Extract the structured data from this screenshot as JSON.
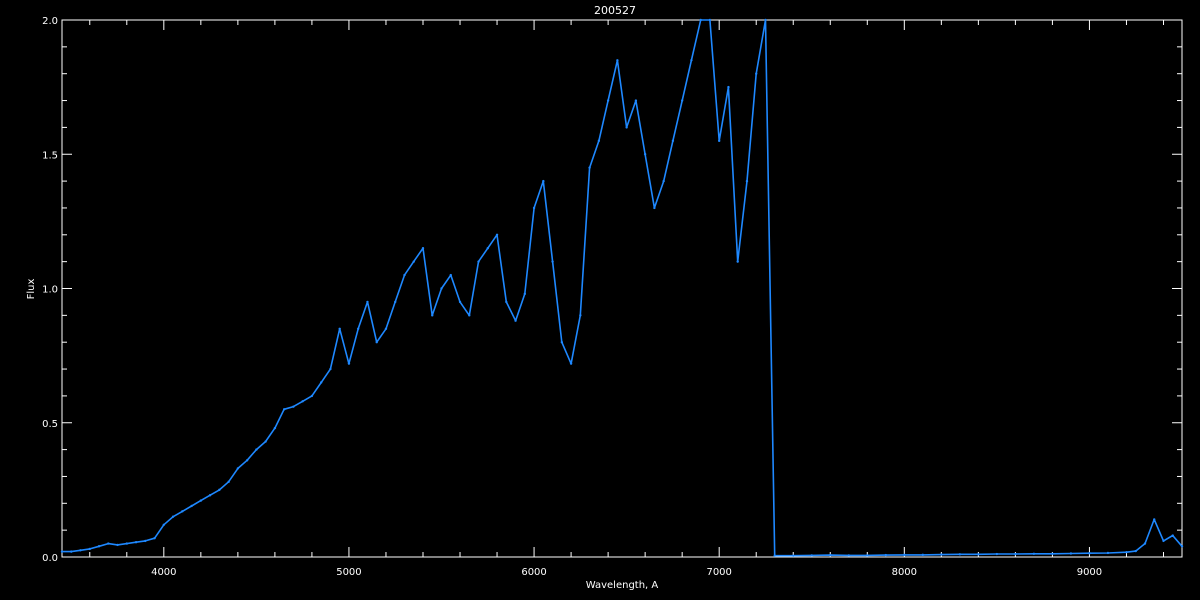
{
  "chart_data": {
    "type": "line",
    "title": "200527",
    "xlabel": "Wavelength, A",
    "ylabel": "Flux",
    "xlim": [
      3450,
      9500
    ],
    "ylim": [
      0,
      2.0
    ],
    "x_ticks": [
      4000,
      5000,
      6000,
      7000,
      8000,
      9000
    ],
    "x_tick_labels": [
      "4000",
      "5000",
      "6000",
      "7000",
      "8000",
      "9000"
    ],
    "y_ticks": [
      0.0,
      0.5,
      1.0,
      1.5,
      2.0
    ],
    "y_tick_labels": [
      "0.0",
      "0.5",
      "1.0",
      "1.5",
      "2.0"
    ],
    "grid": false,
    "colors": {
      "background": "#000000",
      "axes": "#ffffff",
      "series": "#1e88ff"
    },
    "series": [
      {
        "x": [
          3450,
          3500,
          3550,
          3600,
          3650,
          3700,
          3750,
          3800,
          3850,
          3900,
          3950,
          4000,
          4050,
          4100,
          4150,
          4200,
          4250,
          4300,
          4350,
          4400,
          4450,
          4500,
          4550,
          4600,
          4650,
          4700,
          4750,
          4800,
          4850,
          4900,
          4950,
          5000,
          5050,
          5100,
          5150,
          5200,
          5250,
          5300,
          5350,
          5400,
          5450,
          5500,
          5550,
          5600,
          5650,
          5700,
          5750,
          5800,
          5850,
          5900,
          5950,
          6000,
          6050,
          6100,
          6150,
          6200,
          6250,
          6300,
          6350,
          6400,
          6450,
          6500,
          6550,
          6600,
          6650,
          6700,
          6750,
          6800,
          6850,
          6900,
          6950,
          7000,
          7050,
          7100,
          7150,
          7200,
          7250,
          7300,
          7400,
          7500,
          7600,
          7700,
          7800,
          7900,
          8000,
          8100,
          8200,
          8300,
          8400,
          8500,
          8600,
          8700,
          8800,
          8900,
          9000,
          9100,
          9200,
          9250,
          9300,
          9350,
          9400,
          9450,
          9500
        ],
        "y": [
          0.02,
          0.02,
          0.025,
          0.03,
          0.04,
          0.05,
          0.045,
          0.05,
          0.055,
          0.06,
          0.07,
          0.12,
          0.15,
          0.17,
          0.19,
          0.21,
          0.23,
          0.25,
          0.28,
          0.33,
          0.36,
          0.4,
          0.43,
          0.48,
          0.55,
          0.56,
          0.58,
          0.6,
          0.65,
          0.7,
          0.85,
          0.72,
          0.85,
          0.95,
          0.8,
          0.85,
          0.95,
          1.05,
          1.1,
          1.15,
          0.9,
          1.0,
          1.05,
          0.95,
          0.9,
          1.1,
          1.15,
          1.2,
          0.95,
          0.88,
          0.98,
          1.3,
          1.4,
          1.1,
          0.8,
          0.72,
          0.9,
          1.45,
          1.55,
          1.7,
          1.85,
          1.6,
          1.7,
          1.5,
          1.3,
          1.4,
          1.55,
          1.7,
          1.85,
          2.0,
          2.0,
          1.55,
          1.75,
          1.1,
          1.4,
          1.8,
          2.0,
          0.005,
          0.005,
          0.006,
          0.007,
          0.006,
          0.006,
          0.007,
          0.008,
          0.008,
          0.009,
          0.01,
          0.01,
          0.011,
          0.011,
          0.012,
          0.012,
          0.013,
          0.014,
          0.015,
          0.018,
          0.022,
          0.05,
          0.14,
          0.06,
          0.08,
          0.04
        ]
      }
    ]
  }
}
